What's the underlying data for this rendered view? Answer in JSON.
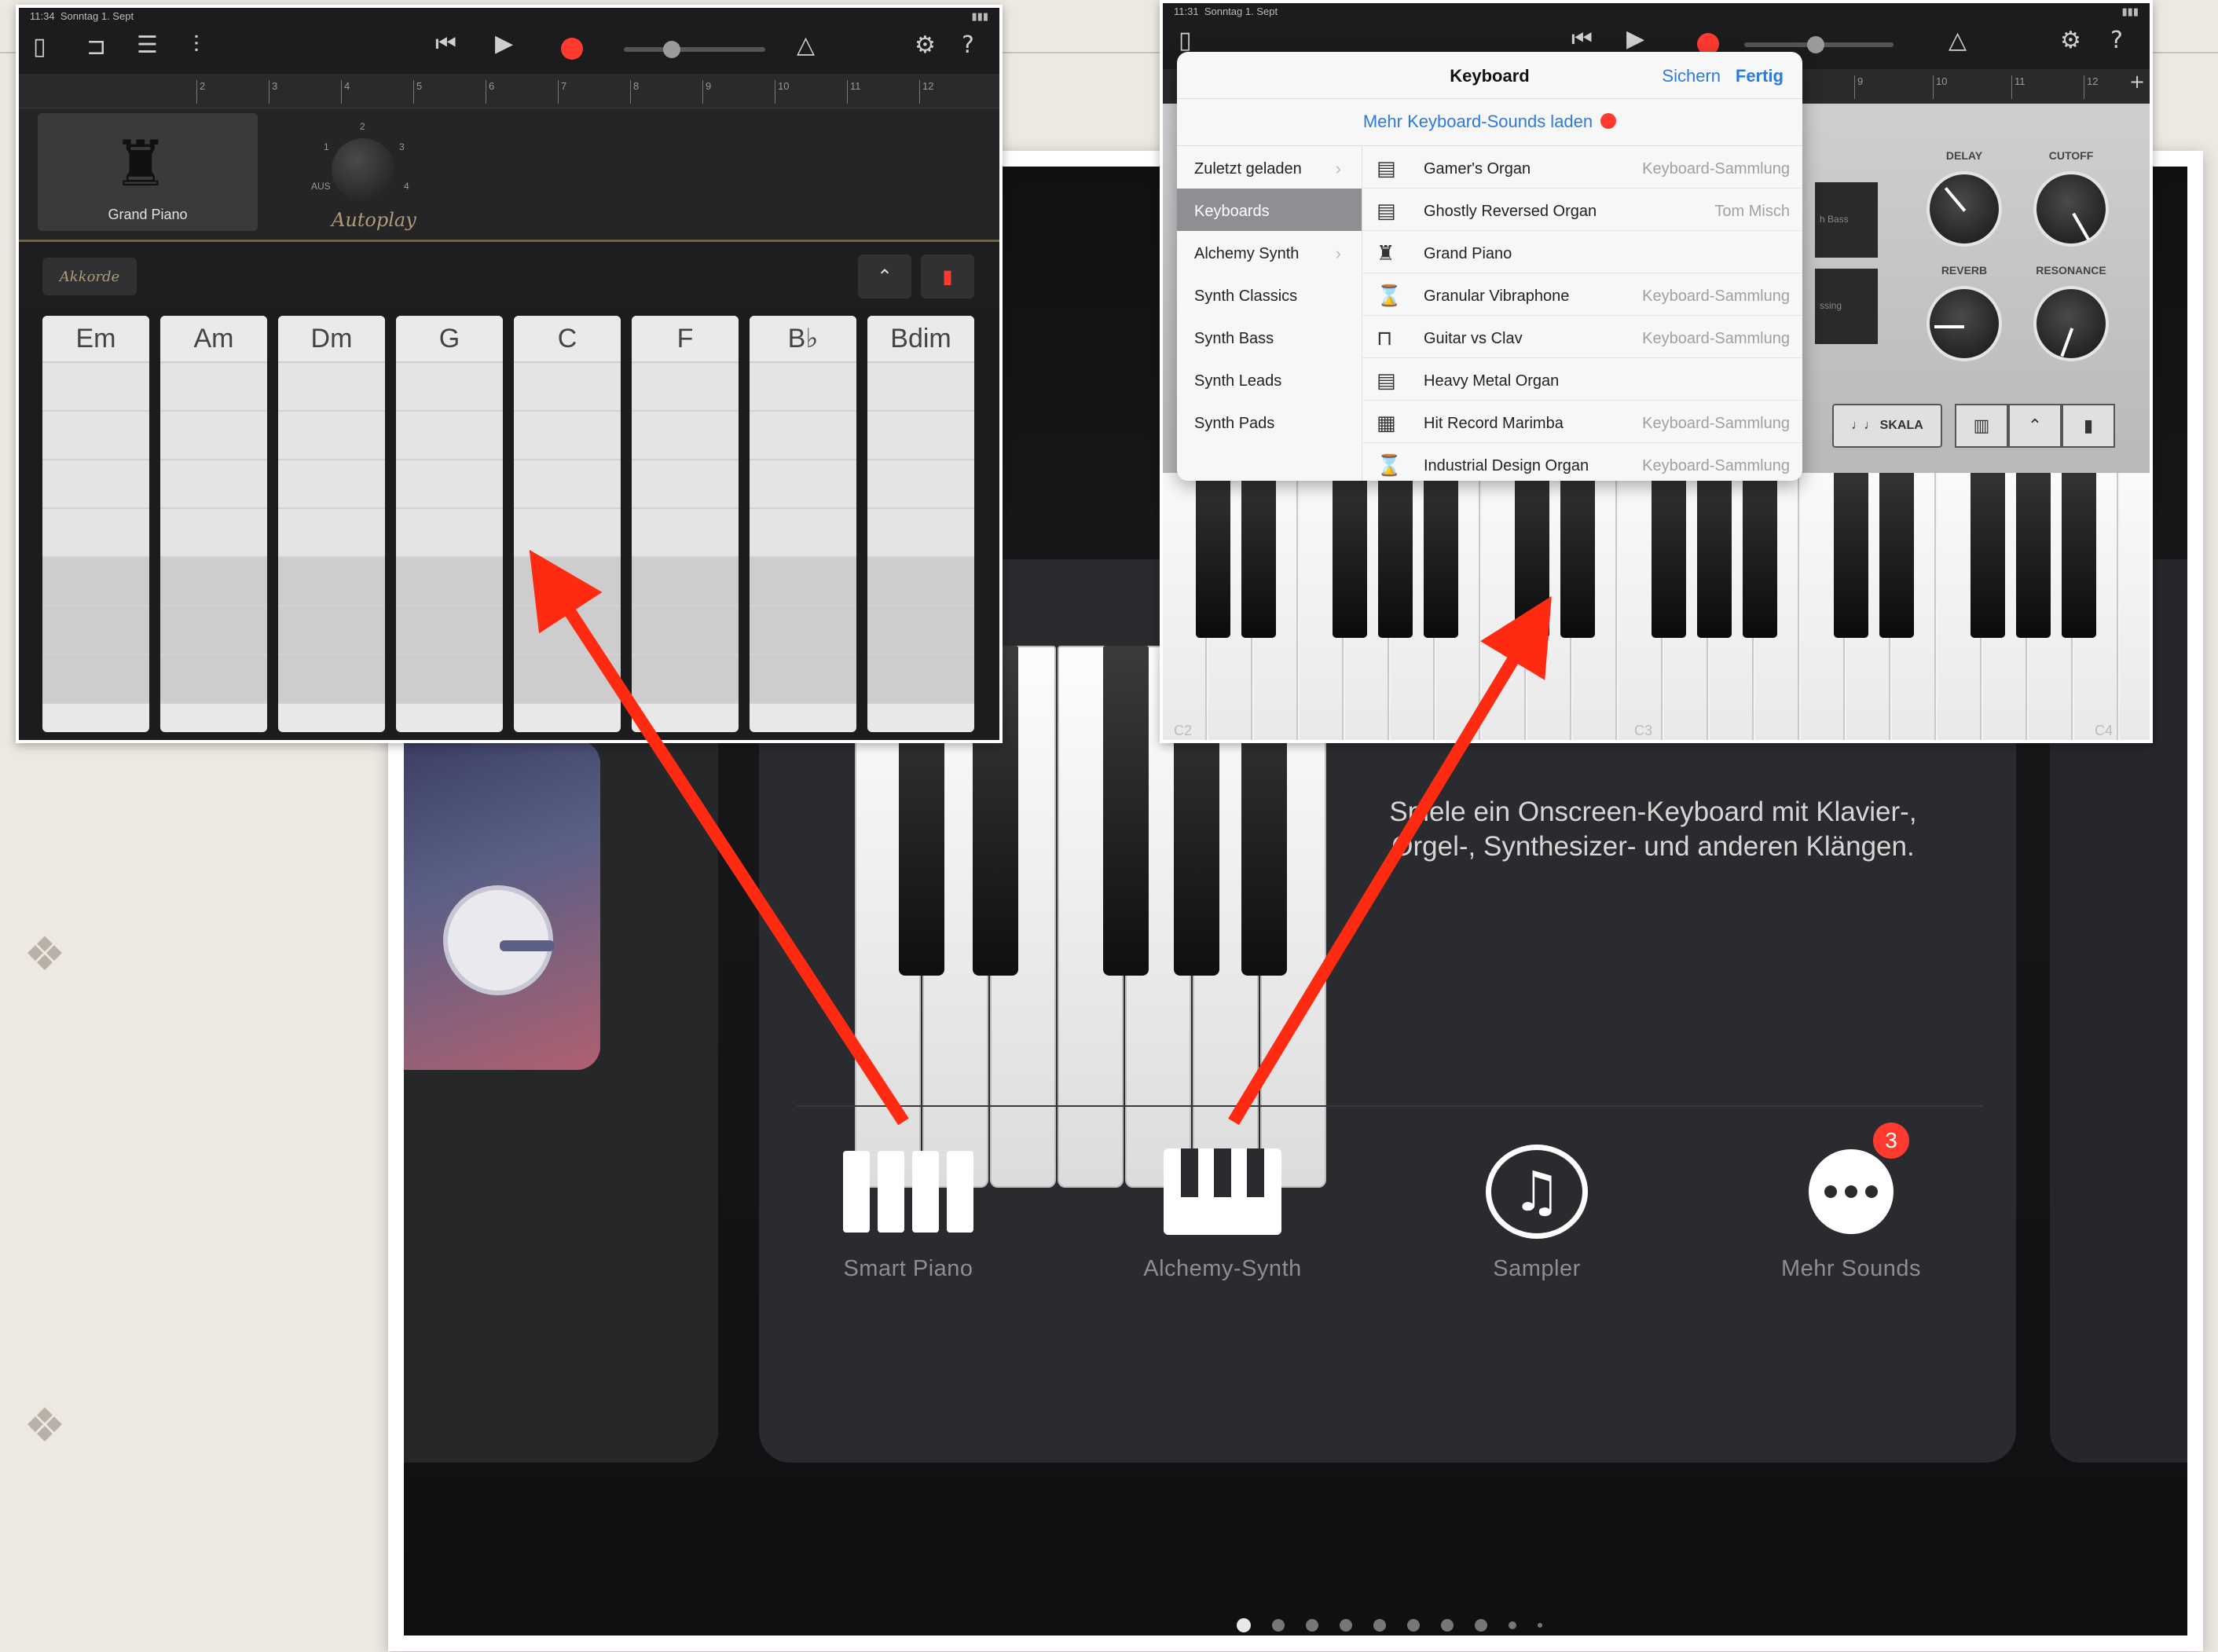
{
  "main": {
    "description": "Spiele ein Onscreen-Keyboard mit Klavier-, Orgel-, Synthesizer- und anderen Klängen.",
    "instruments": [
      {
        "label": "Smart Piano",
        "icon": "piano-bars-icon"
      },
      {
        "label": "Alchemy-Synth",
        "icon": "synth-keys-icon"
      },
      {
        "label": "Sampler",
        "icon": "music-note-bubble-icon"
      },
      {
        "label": "Mehr Sounds",
        "icon": "more-dots-icon",
        "badge": "3"
      }
    ],
    "page_count": 10,
    "active_page": 1
  },
  "left_screen": {
    "status": {
      "time": "11:34",
      "date": "Sonntag 1. Sept"
    },
    "ruler_marks": [
      "2",
      "3",
      "4",
      "5",
      "6",
      "7",
      "8",
      "9",
      "10",
      "11",
      "12"
    ],
    "instrument_name": "Grand Piano",
    "dial_labels": [
      "AUS",
      "1",
      "2",
      "3",
      "4"
    ],
    "autoplay_label": "Autoplay",
    "chords_button": "Akkorde",
    "chords": [
      "Em",
      "Am",
      "Dm",
      "G",
      "C",
      "F",
      "B♭",
      "Bdim"
    ]
  },
  "right_screen": {
    "status": {
      "time": "11:31",
      "date": "Sonntag 1. Sept"
    },
    "ruler_marks": [
      "9",
      "10",
      "11",
      "12"
    ],
    "popover": {
      "title": "Keyboard",
      "save_label": "Sichern",
      "done_label": "Fertig",
      "more_sounds_label": "Mehr Keyboard-Sounds laden"
    },
    "categories": [
      {
        "label": "Zuletzt geladen",
        "chevron": true
      },
      {
        "label": "Keyboards",
        "selected": true
      },
      {
        "label": "Alchemy Synth",
        "chevron": true
      },
      {
        "label": "Synth Classics"
      },
      {
        "label": "Synth Bass"
      },
      {
        "label": "Synth Leads"
      },
      {
        "label": "Synth Pads"
      }
    ],
    "sounds": [
      {
        "name": "Gamer's Organ",
        "source": "Keyboard-Sammlung",
        "icon": "organ-icon"
      },
      {
        "name": "Ghostly Reversed Organ",
        "source": "Tom Misch",
        "icon": "organ-icon"
      },
      {
        "name": "Grand Piano",
        "source": "",
        "icon": "grand-piano-icon"
      },
      {
        "name": "Granular Vibraphone",
        "source": "Keyboard-Sammlung",
        "icon": "vibraphone-icon"
      },
      {
        "name": "Guitar vs Clav",
        "source": "Keyboard-Sammlung",
        "icon": "clav-icon"
      },
      {
        "name": "Heavy Metal Organ",
        "source": "",
        "icon": "organ-icon"
      },
      {
        "name": "Hit Record Marimba",
        "source": "Keyboard-Sammlung",
        "icon": "marimba-icon"
      },
      {
        "name": "Industrial Design Organ",
        "source": "Keyboard-Sammlung",
        "icon": "vibraphone-icon"
      }
    ],
    "knobs": [
      "DELAY",
      "CUTOFF",
      "REVERB",
      "RESONANCE"
    ],
    "side_labels": [
      "h Bass",
      "ssing"
    ],
    "scale_button": "SKALA",
    "octave_labels": [
      "C2",
      "C3",
      "C4"
    ]
  },
  "colors": {
    "annotation_arrow": "#ff2a12",
    "record": "#ff3b30",
    "ios_blue": "#2a7ae2",
    "badge_red": "#ff3b30"
  }
}
